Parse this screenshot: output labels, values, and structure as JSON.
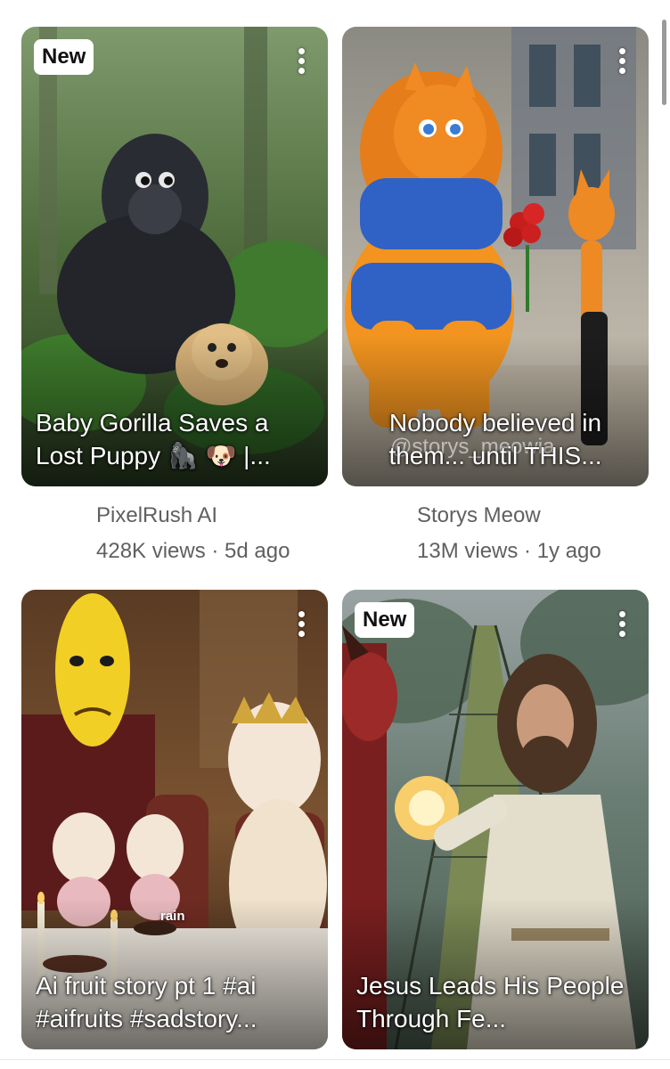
{
  "feed": {
    "items": [
      {
        "badge": "New",
        "title": "Baby Gorilla Saves a Lost Puppy 🦍 🐶 |...",
        "channel": "PixelRush AI",
        "stats": "428K views · 5d ago",
        "menu_icon": "more-vertical-icon"
      },
      {
        "badge": "",
        "title": "Nobody believed in them... until THIS...",
        "watermark": "@storys_meowia",
        "channel": "Storys Meow",
        "stats": "13M views · 1y ago",
        "menu_icon": "more-vertical-icon"
      },
      {
        "badge": "",
        "title": "Ai fruit story pt 1 #ai #aifruits #sadstory...",
        "caption": "rain",
        "menu_icon": "more-vertical-icon"
      },
      {
        "badge": "New",
        "title": "Jesus Leads His People Through Fe...",
        "menu_icon": "more-vertical-icon"
      }
    ]
  },
  "colors": {
    "meta_text": "#606060",
    "badge_bg": "#ffffff",
    "background": "#ffffff"
  }
}
